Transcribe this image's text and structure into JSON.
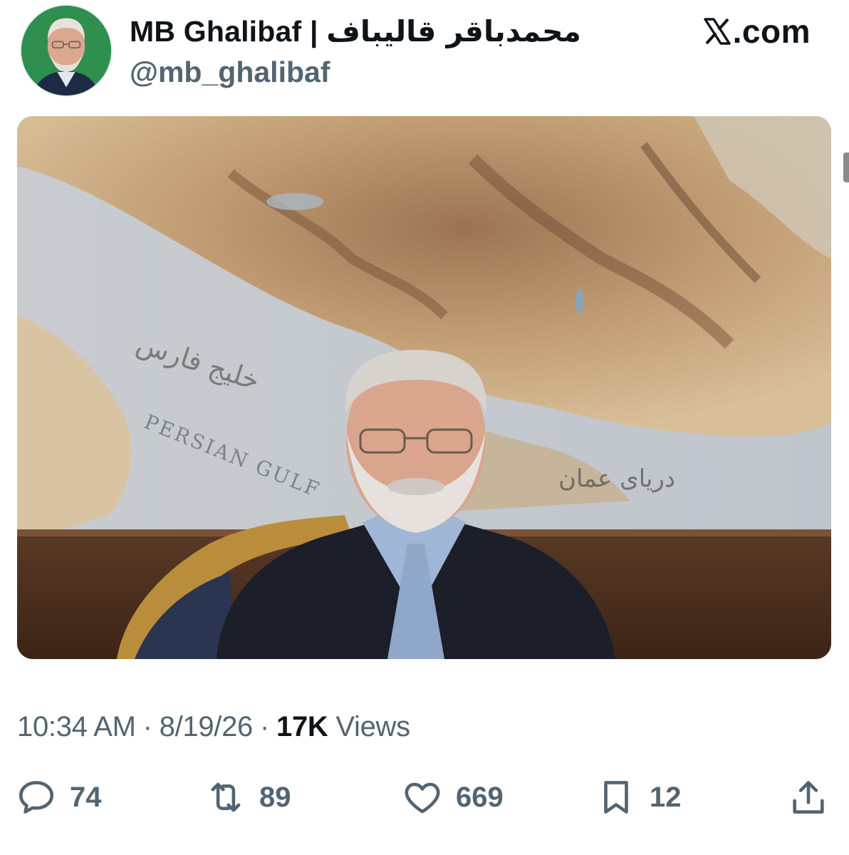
{
  "author": {
    "name": "MB Ghalibaf",
    "name_separator": "|",
    "name_fa": "محمدباقر قالیباف",
    "handle": "@mb_ghalibaf"
  },
  "brand": {
    "text": ".com",
    "icon": "x-logo-icon"
  },
  "media": {
    "map_labels": [
      "خلیج فارس",
      "PERSIAN GULF",
      "دریای عمان"
    ]
  },
  "meta": {
    "time": "10:34 AM",
    "separator": "·",
    "date": "8/19/26",
    "views_count": "17K",
    "views_label": "Views"
  },
  "actions": {
    "reply": {
      "icon": "reply-icon",
      "count": "74"
    },
    "repost": {
      "icon": "repost-icon",
      "count": "89"
    },
    "like": {
      "icon": "heart-icon",
      "count": "669"
    },
    "bookmark": {
      "icon": "bookmark-icon",
      "count": "12"
    },
    "share": {
      "icon": "share-icon"
    }
  },
  "colors": {
    "text": "#0f1419",
    "secondary": "#536471",
    "avatar_bg": "#2f8f4e"
  }
}
